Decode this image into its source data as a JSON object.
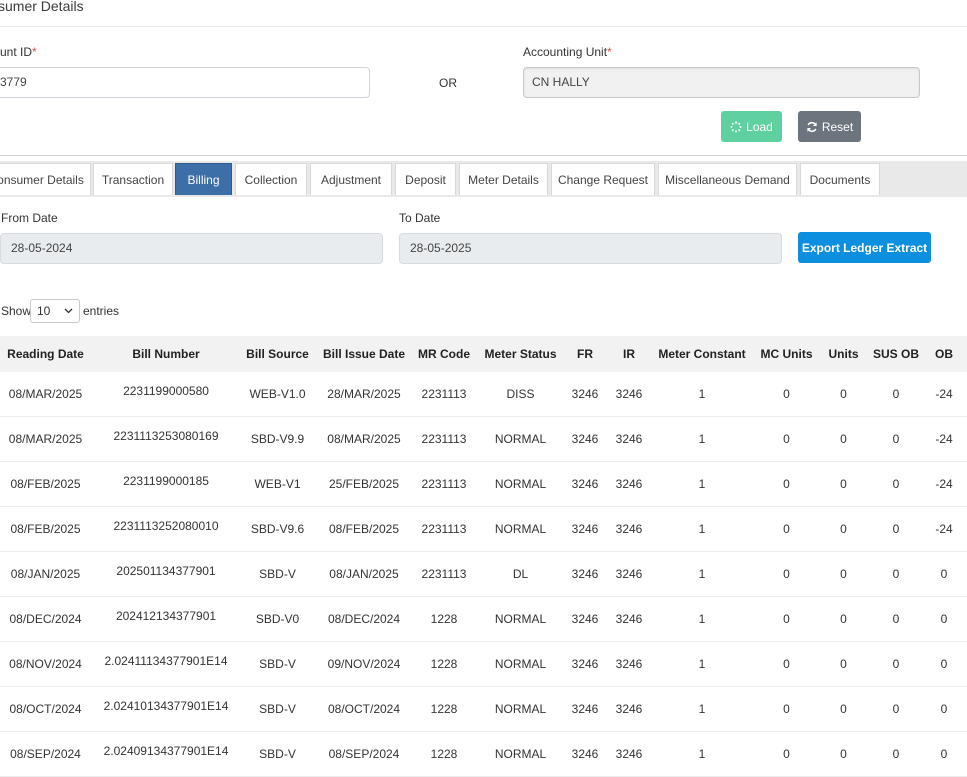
{
  "header": {
    "title": "sumer Details"
  },
  "form": {
    "account_label": "unt ID",
    "account_req": "*",
    "account_value": "3779",
    "or_label": "OR",
    "unit_label": "Accounting Unit",
    "unit_req": "*",
    "unit_value": "CN HALLY",
    "load_label": "Load",
    "reset_label": "Reset"
  },
  "tabs": [
    {
      "label": "onsumer Details"
    },
    {
      "label": "Transaction"
    },
    {
      "label": "Billing",
      "active": true
    },
    {
      "label": "Collection"
    },
    {
      "label": "Adjustment"
    },
    {
      "label": "Deposit"
    },
    {
      "label": "Meter Details"
    },
    {
      "label": "Change Request"
    },
    {
      "label": "Miscellaneous Demand"
    },
    {
      "label": "Documents"
    }
  ],
  "billing": {
    "from_label": "From Date",
    "from_value": "28-05-2024",
    "to_label": "To Date",
    "to_value": "28-05-2025",
    "export_label": "Export Ledger Extract",
    "show_label": "Show",
    "entries_value": "10",
    "entries_label": "entries"
  },
  "table": {
    "columns": [
      "Reading Date",
      "Bill Number",
      "Bill Source",
      "Bill Issue Date",
      "MR Code",
      "Meter Status",
      "FR",
      "IR",
      "Meter Constant",
      "MC Units",
      "Units",
      "SUS OB",
      "OB"
    ],
    "rows": [
      [
        "08/MAR/2025",
        "2231199000580",
        "WEB-V1.0",
        "28/MAR/2025",
        "2231113",
        "DISS",
        "3246",
        "3246",
        "1",
        "0",
        "0",
        "0",
        "-24"
      ],
      [
        "08/MAR/2025",
        "2231113253080169",
        "SBD-V9.9",
        "08/MAR/2025",
        "2231113",
        "NORMAL",
        "3246",
        "3246",
        "1",
        "0",
        "0",
        "0",
        "-24"
      ],
      [
        "08/FEB/2025",
        "2231199000185",
        "WEB-V1",
        "25/FEB/2025",
        "2231113",
        "NORMAL",
        "3246",
        "3246",
        "1",
        "0",
        "0",
        "0",
        "-24"
      ],
      [
        "08/FEB/2025",
        "2231113252080010",
        "SBD-V9.6",
        "08/FEB/2025",
        "2231113",
        "NORMAL",
        "3246",
        "3246",
        "1",
        "0",
        "0",
        "0",
        "-24"
      ],
      [
        "08/JAN/2025",
        "202501134377901",
        "SBD-V",
        "08/JAN/2025",
        "2231113",
        "DL",
        "3246",
        "3246",
        "1",
        "0",
        "0",
        "0",
        "0"
      ],
      [
        "08/DEC/2024",
        "202412134377901",
        "SBD-V0",
        "08/DEC/2024",
        "1228",
        "NORMAL",
        "3246",
        "3246",
        "1",
        "0",
        "0",
        "0",
        "0"
      ],
      [
        "08/NOV/2024",
        "2.02411134377901E14",
        "SBD-V",
        "09/NOV/2024",
        "1228",
        "NORMAL",
        "3246",
        "3246",
        "1",
        "0",
        "0",
        "0",
        "0"
      ],
      [
        "08/OCT/2024",
        "2.02410134377901E14",
        "SBD-V",
        "08/OCT/2024",
        "1228",
        "NORMAL",
        "3246",
        "3246",
        "1",
        "0",
        "0",
        "0",
        "0"
      ],
      [
        "08/SEP/2024",
        "2.02409134377901E14",
        "SBD-V",
        "08/SEP/2024",
        "1228",
        "NORMAL",
        "3246",
        "3246",
        "1",
        "0",
        "0",
        "0",
        "0"
      ]
    ]
  },
  "icons": {
    "load": "spinner-icon",
    "reset": "refresh-icon",
    "select": "chevron-down-icon"
  },
  "colors": {
    "active_tab": "#3c6fa8",
    "load_button": "#5fd0a0",
    "reset_button": "#6c757d",
    "export_button": "#0d8fe0",
    "required": "#d9534f"
  }
}
